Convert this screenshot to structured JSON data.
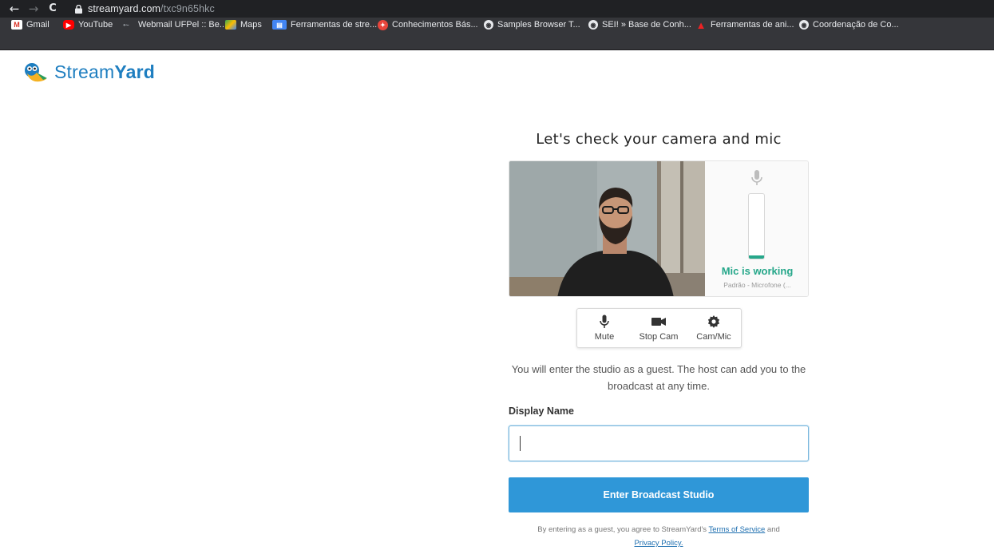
{
  "browser": {
    "url_domain": "streamyard.com",
    "url_path": "/txc9n65hkc",
    "nav": {
      "back": "←",
      "forward": "→",
      "reload": "C"
    }
  },
  "bookmarks": [
    {
      "label": "Gmail",
      "icon": "gmail-icon",
      "color": "#d93025"
    },
    {
      "label": "YouTube",
      "icon": "youtube-icon",
      "color": "#ff0000"
    },
    {
      "label": "Webmail UFPel :: Be...",
      "icon": "webmail-icon",
      "color": "#9aa0a6"
    },
    {
      "label": "Maps",
      "icon": "maps-icon",
      "color": "#34a853"
    },
    {
      "label": "Ferramentas de stre...",
      "icon": "tools-icon",
      "color": "#4285f4"
    },
    {
      "label": "Conhecimentos Bás...",
      "icon": "knowledge-icon",
      "color": "#e8453c"
    },
    {
      "label": "Samples Browser T...",
      "icon": "globe-icon",
      "color": "#e8eaed"
    },
    {
      "label": "SEI! » Base de Conh...",
      "icon": "globe-icon",
      "color": "#e8eaed"
    },
    {
      "label": "Ferramentas de ani...",
      "icon": "adobe-icon",
      "color": "#ed2224"
    },
    {
      "label": "Coordenação de Co...",
      "icon": "globe-icon",
      "color": "#e8eaed"
    }
  ],
  "logo": {
    "part1": "Stream",
    "part2": "Yard",
    "color": "#1e7ec0"
  },
  "page": {
    "title": "Let's check your camera and mic",
    "mic_status": "Mic is working",
    "mic_device": "Padrão - Microfone (...",
    "mic_level": 0.05,
    "controls": [
      {
        "label": "Mute",
        "icon": "microphone-icon"
      },
      {
        "label": "Stop Cam",
        "icon": "video-camera-icon"
      },
      {
        "label": "Cam/Mic",
        "icon": "gear-icon"
      }
    ],
    "guest_note": "You will enter the studio as a guest. The host can add you to the broadcast at any time.",
    "display_name_label": "Display Name",
    "display_name_value": "",
    "enter_button": "Enter Broadcast Studio",
    "legal_prefix": "By entering as a guest, you agree to StreamYard's",
    "terms_link": "Terms of Service",
    "legal_and": "and",
    "privacy_link": "Privacy Policy."
  },
  "colors": {
    "accent": "#2f97d8",
    "success": "#26a78a"
  }
}
